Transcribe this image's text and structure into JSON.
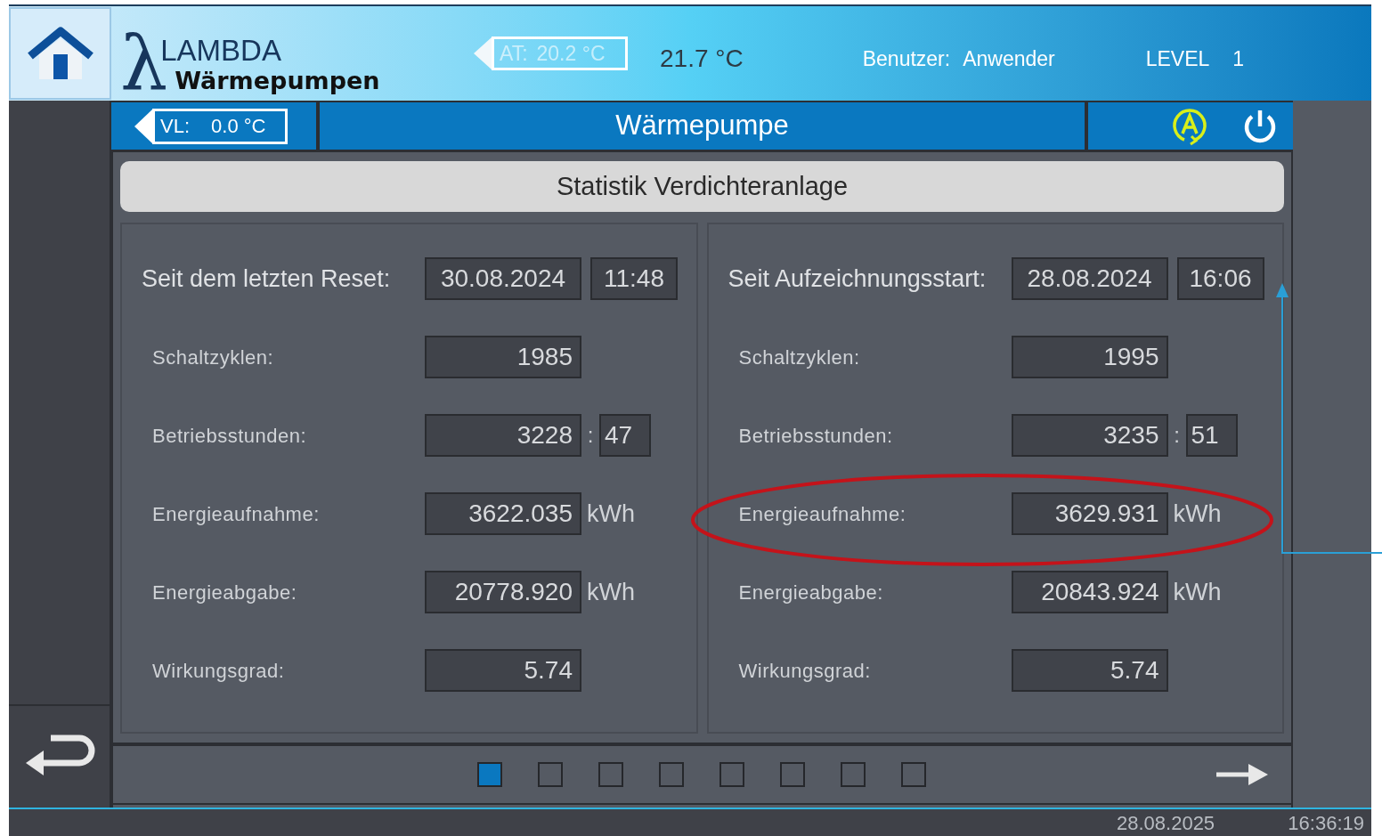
{
  "header": {
    "logo": {
      "symbol": "λ",
      "line1": "LAMBDA",
      "line2": "Wärmepumpen"
    },
    "outdoor": {
      "label": "AT:",
      "value": "20.2 °C"
    },
    "room_temp": "21.7 °C",
    "user_label": "Benutzer:",
    "user": "Anwender",
    "level_label": "LEVEL",
    "level": "1"
  },
  "subheader": {
    "flow": {
      "label": "VL:",
      "value": "0.0 °C"
    },
    "title": "Wärmepumpe",
    "auto_mode": true
  },
  "page_title": "Statistik Verdichteranlage",
  "panels": [
    {
      "since_label": "Seit dem letzten Reset:",
      "date": "30.08.2024",
      "time": "11:48",
      "rows": [
        {
          "kind": "plain",
          "label": "Schaltzyklen:",
          "value": "1985"
        },
        {
          "kind": "pair",
          "label": "Betriebsstunden:",
          "value": "3228",
          "separator": ":",
          "value2": "47"
        },
        {
          "kind": "unit",
          "label": "Energieaufnahme:",
          "value": "3622.035",
          "unit": "kWh"
        },
        {
          "kind": "unit",
          "label": "Energieabgabe:",
          "value": "20778.920",
          "unit": "kWh"
        },
        {
          "kind": "plain",
          "label": "Wirkungsgrad:",
          "value": "5.74"
        }
      ]
    },
    {
      "since_label": "Seit Aufzeichnungsstart:",
      "date": "28.08.2024",
      "time": "16:06",
      "rows": [
        {
          "kind": "plain",
          "label": "Schaltzyklen:",
          "value": "1995"
        },
        {
          "kind": "pair",
          "label": "Betriebsstunden:",
          "value": "3235",
          "separator": ":",
          "value2": "51"
        },
        {
          "kind": "unit",
          "label": "Energieaufnahme:",
          "value": "3629.931",
          "unit": "kWh"
        },
        {
          "kind": "unit",
          "label": "Energieabgabe:",
          "value": "20843.924",
          "unit": "kWh"
        },
        {
          "kind": "plain",
          "label": "Wirkungsgrad:",
          "value": "5.74"
        }
      ]
    }
  ],
  "pager": [
    {
      "selected": true
    },
    {
      "selected": false
    },
    {
      "selected": false
    },
    {
      "selected": false
    },
    {
      "selected": false
    },
    {
      "selected": false
    },
    {
      "selected": false
    },
    {
      "selected": false
    }
  ],
  "status_bar": {
    "date": "28.08.2025",
    "time": "16:36:19"
  }
}
